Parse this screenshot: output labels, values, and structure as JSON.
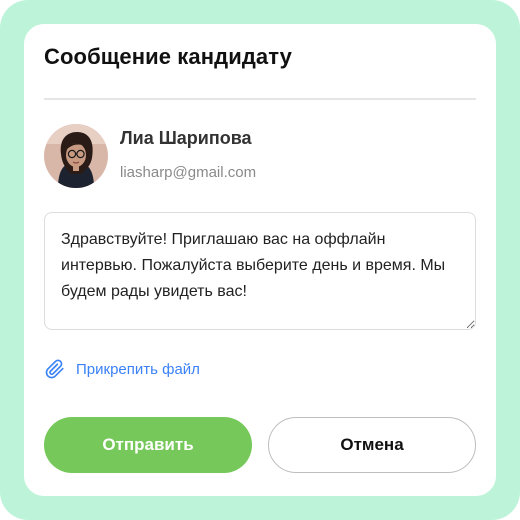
{
  "dialog": {
    "title": "Сообщение кандидату"
  },
  "candidate": {
    "name": "Лиа Шарипова",
    "email": "liasharp@gmail.com"
  },
  "message": {
    "text": "Здравствуйте! Приглашаю вас на оффлайн интервью. Пожалуйста выберите день и время. Мы будем рады увидеть вас!"
  },
  "attachment": {
    "label": "Прикрепить файл",
    "icon": "paperclip-icon"
  },
  "actions": {
    "send_label": "Отправить",
    "cancel_label": "Отмена"
  },
  "colors": {
    "frame_background": "#bdf3d8",
    "primary_button": "#76c85a",
    "link": "#3b82f6"
  }
}
